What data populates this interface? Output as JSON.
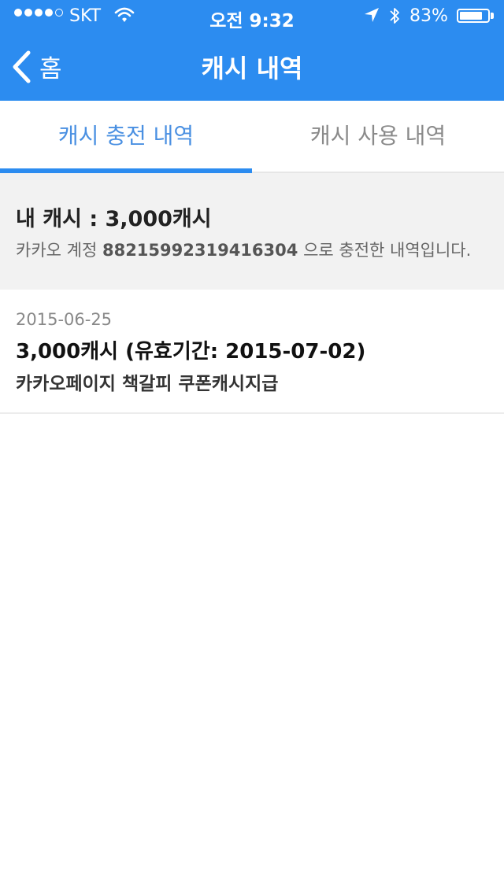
{
  "status_bar": {
    "carrier": "SKT",
    "time": "오전 9:32",
    "battery_pct": "83%",
    "battery_level": 0.83,
    "signal_bars_filled": 4,
    "signal_bars_total": 5
  },
  "nav": {
    "back_label": "홈",
    "title": "캐시 내역",
    "bg_color": "#2c8cf0"
  },
  "tabs": {
    "active_label": "캐시 충전 내역",
    "inactive_label": "캐시 사용 내역",
    "active_color": "#4a90e2"
  },
  "summary": {
    "balance": "내 캐시 : 3,000캐시",
    "desc_prefix": "카카오 계정",
    "account": "88215992319416304",
    "desc_suffix": "으로 충전한 내역입니다."
  },
  "history": [
    {
      "date": "2015-06-25",
      "amount": "3,000캐시 (유효기간: 2015-07-02)",
      "description": "카카오페이지 책갈피 쿠폰캐시지급"
    }
  ]
}
